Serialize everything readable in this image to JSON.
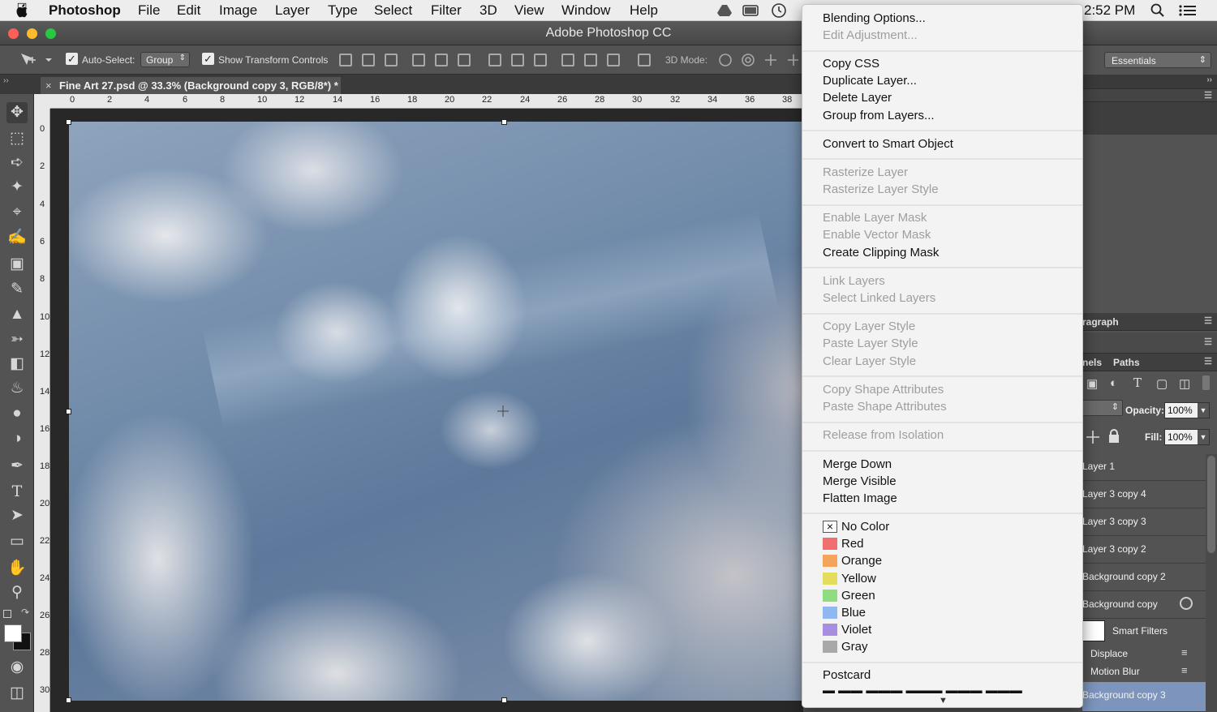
{
  "menubar": {
    "apple": "",
    "app_name": "Photoshop",
    "items": [
      "File",
      "Edit",
      "Image",
      "Layer",
      "Type",
      "Select",
      "Filter",
      "3D",
      "View",
      "Window",
      "Help"
    ],
    "clock": "2:52 PM"
  },
  "window": {
    "title": "Adobe Photoshop CC"
  },
  "options_bar": {
    "auto_select_label": "Auto-Select:",
    "auto_select_value": "Group",
    "show_transform_label": "Show Transform Controls",
    "mode_3d_label": "3D Mode:",
    "workspace": "Essentials"
  },
  "document": {
    "tab_title": "Fine Art 27.psd @ 33.3% (Background copy 3, RGB/8*) *",
    "close_glyph": "×"
  },
  "ruler": {
    "h_labels": [
      "0",
      "2",
      "4",
      "6",
      "8",
      "10",
      "12",
      "14",
      "16",
      "18",
      "20",
      "22",
      "24",
      "26",
      "28",
      "30",
      "32",
      "34",
      "36",
      "38"
    ],
    "v_labels": [
      "0",
      "2",
      "4",
      "6",
      "8",
      "10",
      "12",
      "14",
      "16",
      "18",
      "20",
      "22",
      "24",
      "26",
      "28",
      "30"
    ]
  },
  "context_menu": {
    "group1": [
      "Blending Options...",
      "Edit Adjustment..."
    ],
    "group2": [
      "Copy CSS",
      "Duplicate Layer...",
      "Delete Layer",
      "Group from Layers..."
    ],
    "group3": [
      "Convert to Smart Object"
    ],
    "group4": [
      "Rasterize Layer",
      "Rasterize Layer Style"
    ],
    "group5": [
      "Enable Layer Mask",
      "Enable Vector Mask",
      "Create Clipping Mask"
    ],
    "group6": [
      "Link Layers",
      "Select Linked Layers"
    ],
    "group7": [
      "Copy Layer Style",
      "Paste Layer Style",
      "Clear Layer Style"
    ],
    "group8": [
      "Copy Shape Attributes",
      "Paste Shape Attributes"
    ],
    "group9": [
      "Release from Isolation"
    ],
    "group10": [
      "Merge Down",
      "Merge Visible",
      "Flatten Image"
    ],
    "colors": [
      {
        "label": "No Color",
        "color": "#ffffff"
      },
      {
        "label": "Red",
        "color": "#f07070"
      },
      {
        "label": "Orange",
        "color": "#f4a55a"
      },
      {
        "label": "Yellow",
        "color": "#e4dc5c"
      },
      {
        "label": "Green",
        "color": "#8fdd7f"
      },
      {
        "label": "Blue",
        "color": "#8fb8f0"
      },
      {
        "label": "Violet",
        "color": "#a98de0"
      },
      {
        "label": "Gray",
        "color": "#a8a8a8"
      }
    ],
    "no_color_mark": "×",
    "group12": [
      "Postcard"
    ],
    "scroll_arrow": "▼"
  },
  "panels": {
    "paragraph_tab": "ragraph",
    "channels_tab": "nels",
    "paths_tab": "Paths",
    "opacity_label": "Opacity:",
    "opacity_value": "100%",
    "fill_label": "Fill:",
    "fill_value": "100%",
    "layers": [
      "Layer 1",
      "Layer 3 copy 4",
      "Layer 3 copy 3",
      "Layer 3 copy 2",
      "Background copy 2",
      "Background copy"
    ],
    "smart_filters": "Smart Filters",
    "filters": [
      "Displace",
      "Motion Blur"
    ],
    "selected_layer": "Background copy 3"
  },
  "colors": {
    "accent": "#7d95bd",
    "panel_bg": "#535353",
    "menu_bg": "#f3f3f3"
  }
}
